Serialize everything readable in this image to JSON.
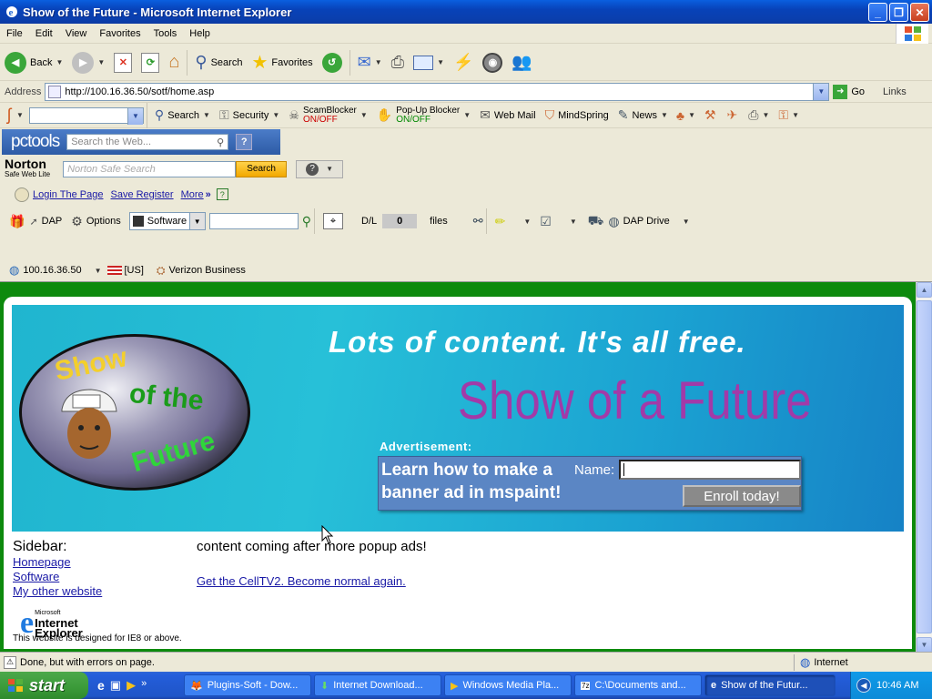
{
  "window": {
    "title": "Show of the Future - Microsoft Internet Explorer"
  },
  "menu": [
    "File",
    "Edit",
    "View",
    "Favorites",
    "Tools",
    "Help"
  ],
  "toolbar": {
    "back": "Back",
    "search": "Search",
    "favorites": "Favorites"
  },
  "address": {
    "label": "Address",
    "url": "http://100.16.36.50/sotf/home.asp",
    "go": "Go",
    "links": "Links"
  },
  "toolbar2": {
    "search": "Search",
    "security": "Security",
    "scamblocker": "ScamBlocker",
    "scam_state": "ON/OFF",
    "popup": "Pop-Up Blocker",
    "popup_state": "ON/OFF",
    "webmail": "Web Mail",
    "mindspring": "MindSpring",
    "news": "News"
  },
  "pctools": {
    "logo": "pctools",
    "placeholder": "Search the Web..."
  },
  "norton": {
    "logo": "Norton",
    "sub": "Safe Web Lite",
    "placeholder": "Norton Safe Search",
    "button": "Search"
  },
  "links_bar": {
    "login": "Login The Page",
    "save": "Save Register",
    "more": "More"
  },
  "dap": {
    "dap": "DAP",
    "options": "Options",
    "software": "Software",
    "dl": "D/L",
    "dl_count": "0",
    "files": "files",
    "drive": "DAP Drive"
  },
  "ipbar": {
    "ip": "100.16.36.50",
    "country": "[US]",
    "isp": "Verizon Business"
  },
  "banner": {
    "headline": "Lots of content. It's all free.",
    "title": "Show of a Future",
    "logo_line1": "Show",
    "logo_line2": "of the",
    "logo_line3": "Future",
    "ad_label": "Advertisement:",
    "ad_text_1": "Learn how to make a",
    "ad_text_2": "banner ad in mspaint!",
    "name_label": "Name:",
    "enroll": "Enroll today!"
  },
  "sidebar": {
    "heading": "Sidebar:",
    "links": [
      "Homepage",
      "Software",
      "My other website"
    ],
    "ie_brand_small": "Microsoft",
    "ie_brand_1": "Internet",
    "ie_brand_2": "Explorer",
    "note": "This website is designed for IE8 or above."
  },
  "main": {
    "text": "content coming after more popup ads!",
    "link": "Get the CellTV2. Become normal again."
  },
  "status": {
    "text": "Done, but with errors on page.",
    "zone": "Internet"
  },
  "taskbar": {
    "start": "start",
    "tasks": [
      "Plugins-Soft - Dow...",
      "Internet Download...",
      "Windows Media Pla...",
      "C:\\Documents and...",
      "Show of the Futur..."
    ],
    "clock": "10:46 AM"
  }
}
